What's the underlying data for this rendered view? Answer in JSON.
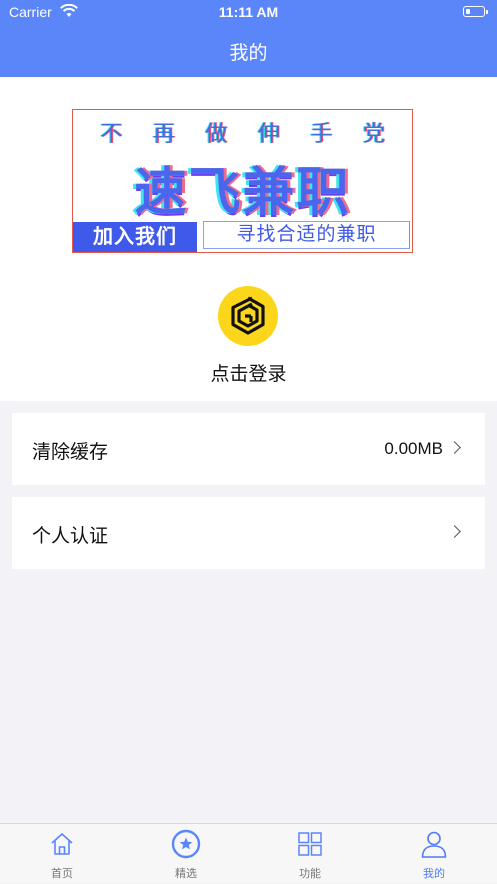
{
  "status_bar": {
    "carrier": "Carrier",
    "time": "11:11 AM"
  },
  "nav": {
    "title": "我的"
  },
  "banner": {
    "top_chars": [
      "不",
      "再",
      "做",
      "伸",
      "手",
      "党"
    ],
    "main": "速飞兼职",
    "join": "加入我们",
    "slogan": "寻找合适的兼职"
  },
  "profile": {
    "logo_icon": "app-logo-icon",
    "login_label": "点击登录"
  },
  "settings": [
    {
      "label": "清除缓存",
      "value": "0.00MB"
    },
    {
      "label": "个人认证",
      "value": ""
    }
  ],
  "tabs": [
    {
      "label": "首页",
      "icon": "home-icon",
      "active": false
    },
    {
      "label": "精选",
      "icon": "star-circle-icon",
      "active": false
    },
    {
      "label": "功能",
      "icon": "grid-icon",
      "active": false
    },
    {
      "label": "我的",
      "icon": "person-icon",
      "active": true
    }
  ],
  "colors": {
    "primary": "#5b86f9",
    "tab_active": "#4f7cf6",
    "logo_yellow": "#fcd61a",
    "background": "#f2f2f7"
  }
}
